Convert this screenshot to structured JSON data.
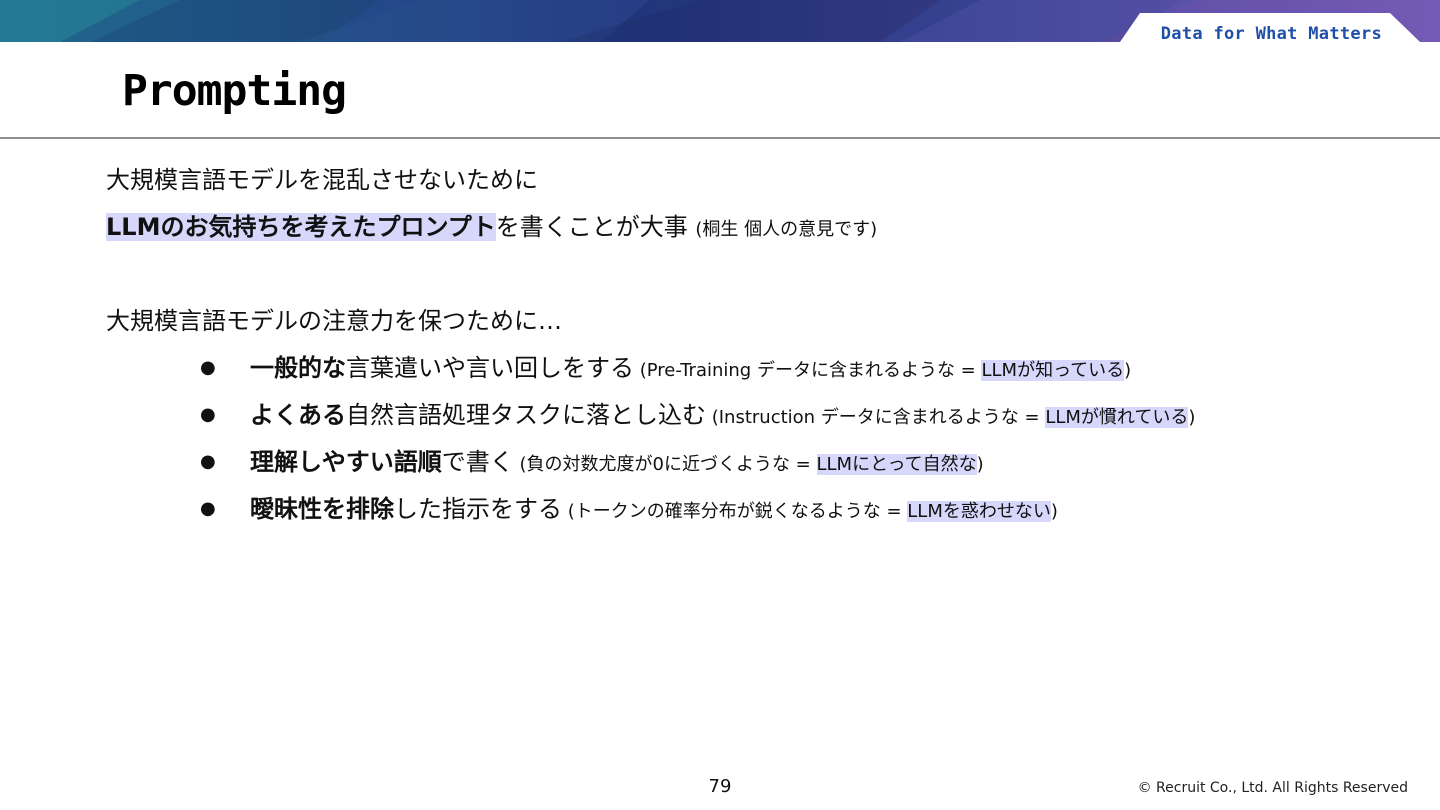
{
  "header": {
    "tagline": "Data for What Matters",
    "title": "Prompting"
  },
  "body": {
    "line1": "大規模言語モデルを混乱させないために",
    "line2": {
      "highlight": "LLMのお気持ちを考えたプロンプト",
      "text": "を書くことが大事",
      "note": "(桐生 個人の意見です)"
    },
    "line3": "大規模言語モデルの注意力を保つために…"
  },
  "bullets": [
    {
      "bold": "一般的な",
      "text": "言葉遣いや言い回しをする",
      "paren_open": " (Pre-Training データに含まれるような = ",
      "highlight": "LLMが知っている",
      "paren_close": ")"
    },
    {
      "bold": "よくある",
      "text": "自然言語処理タスクに落とし込む",
      "paren_open": " (Instruction データに含まれるような = ",
      "highlight": "LLMが慣れている",
      "paren_close": ")"
    },
    {
      "bold": "理解しやすい語順",
      "text": "で書く",
      "paren_open": " (負の対数尤度が0に近づくような = ",
      "highlight": "LLMにとって自然な",
      "paren_close": ")"
    },
    {
      "bold": "曖昧性を排除",
      "text": "した指示をする",
      "paren_open": " (トークンの確率分布が鋭くなるような = ",
      "highlight": "LLMを惑わせない",
      "paren_close": ")"
    }
  ],
  "footer": {
    "page_number": "79",
    "copyright": "© Recruit Co., Ltd. All Rights Reserved"
  },
  "colors": {
    "highlight": "#d6d7fb",
    "tagline": "#1f4fa8",
    "banner_left": "#1e6f8a",
    "banner_mid": "#24357a",
    "banner_right": "#7a5bb5"
  }
}
